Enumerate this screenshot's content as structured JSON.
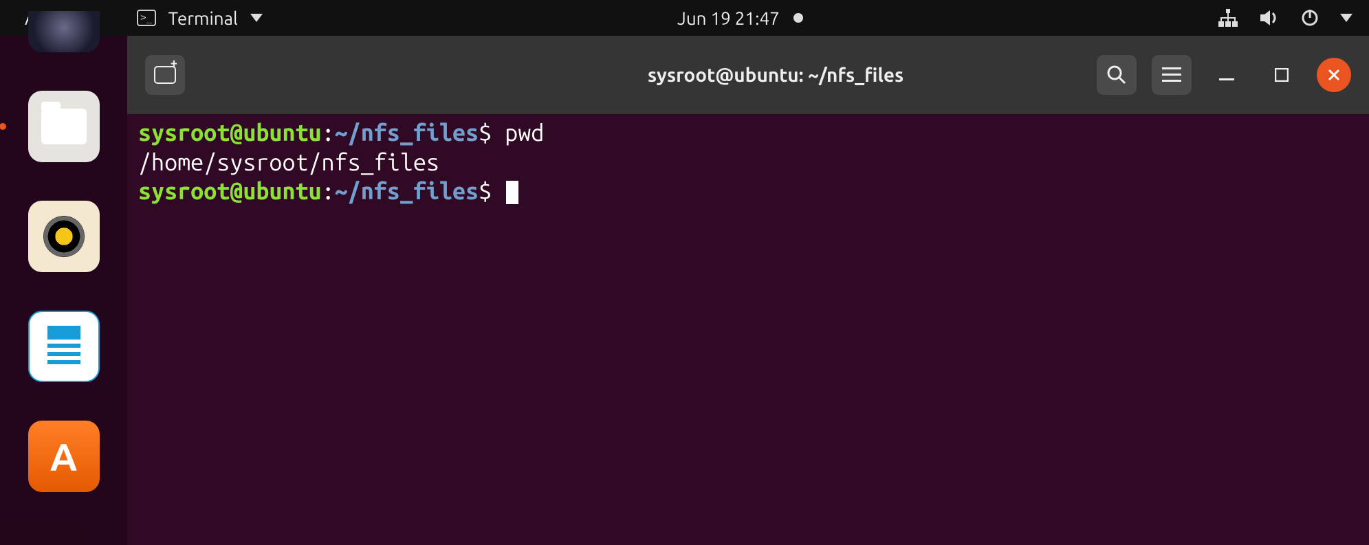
{
  "topbar": {
    "activities": "Activities",
    "app_name": "Terminal",
    "datetime": "Jun 19  21:47"
  },
  "dock": {
    "items": [
      {
        "name": "firefox",
        "active": false
      },
      {
        "name": "files",
        "active": true
      },
      {
        "name": "rhythmbox",
        "active": false
      },
      {
        "name": "writer",
        "active": false
      },
      {
        "name": "software",
        "active": false
      }
    ]
  },
  "window": {
    "title": "sysroot@ubuntu: ~/nfs_files"
  },
  "terminal": {
    "prompt_user_host": "sysroot@ubuntu",
    "prompt_path": "~/nfs_files",
    "lines": [
      {
        "type": "prompt",
        "command": "pwd"
      },
      {
        "type": "output",
        "text": "/home/sysroot/nfs_files"
      },
      {
        "type": "prompt",
        "command": ""
      }
    ]
  }
}
